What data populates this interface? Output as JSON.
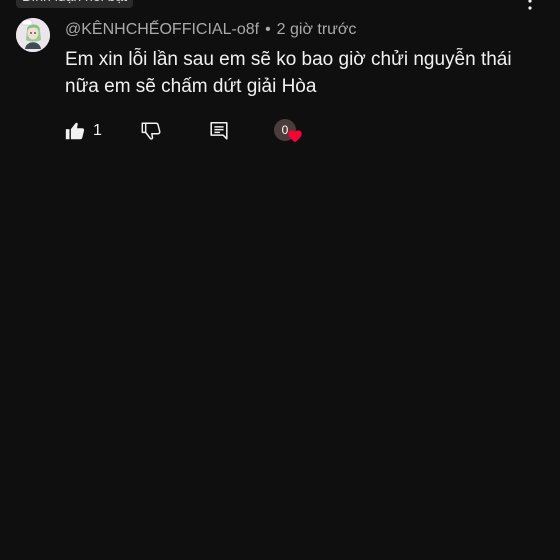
{
  "header": {
    "chip_label": "Bình luận nổi bật",
    "more_icon": "more-vertical-icon"
  },
  "comment": {
    "author_handle": "@KÊNHCHẾOFFICIAL-o8f",
    "separator": "•",
    "timestamp": "2 giờ trước",
    "text": "Em xin lỗi lần sau em sẽ ko bao giờ chửi nguyễn thái nữa em sẽ chấm dứt giải Hòa",
    "like_count": "1",
    "creator_heart_avatar_text": "0",
    "icons": {
      "like": "thumbs-up-icon",
      "dislike": "thumbs-down-icon",
      "reply": "reply-comment-icon",
      "heart": "heart-icon"
    },
    "colors": {
      "background": "#0f0f0f",
      "text_primary": "#f1f1f1",
      "text_secondary": "#aaaaaa",
      "heart": "#ff0033"
    }
  }
}
